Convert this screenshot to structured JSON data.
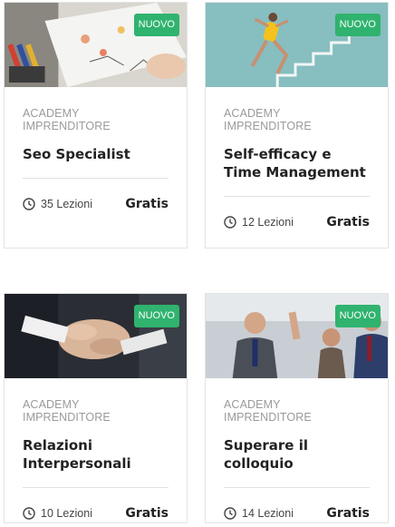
{
  "courses": [
    {
      "badge": "NUOVO",
      "category": "ACADEMY IMPRENDITORE",
      "title": "Seo Specialist",
      "lessons": "35 Lezioni",
      "price": "Gratis"
    },
    {
      "badge": "NUOVO",
      "category": "ACADEMY IMPRENDITORE",
      "title": "Self-efficacy e Time Management",
      "lessons": "12 Lezioni",
      "price": "Gratis"
    },
    {
      "badge": "NUOVO",
      "category": "ACADEMY IMPRENDITORE",
      "title": "Relazioni Interpersonali",
      "lessons": "10 Lezioni",
      "price": "Gratis"
    },
    {
      "badge": "NUOVO",
      "category": "ACADEMY IMPRENDITORE",
      "title": "Superare il colloquio",
      "lessons": "14 Lezioni",
      "price": "Gratis"
    }
  ],
  "colors": {
    "badge": "#2fb36e",
    "category": "#9a9a9a",
    "border": "#e3e3e3"
  },
  "icons": {
    "lessons": "clock-icon"
  }
}
